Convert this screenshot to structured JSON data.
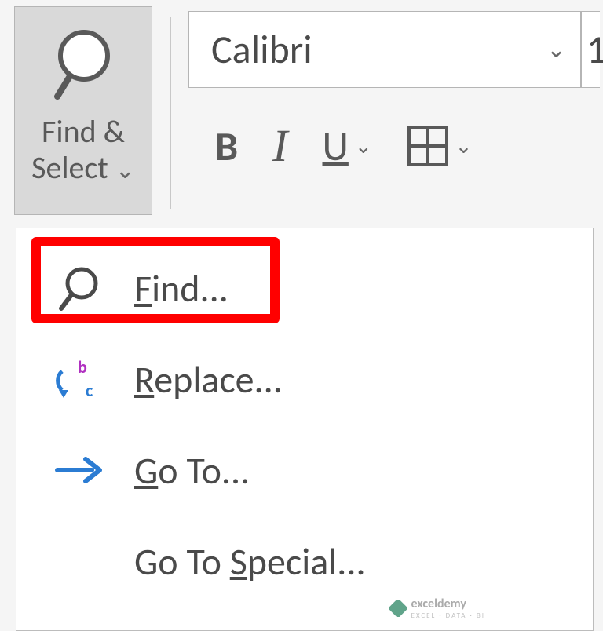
{
  "ribbon": {
    "find_select": {
      "label": "Find &\nSelect"
    },
    "font_name": "Calibri",
    "font_size_partial": "1",
    "bold": "B",
    "italic": "I",
    "underline": "U"
  },
  "menu": {
    "find": {
      "prefix": "F",
      "rest": "ind..."
    },
    "replace": {
      "prefix": "R",
      "rest": "eplace..."
    },
    "goto": {
      "prefix": "G",
      "rest": "o To..."
    },
    "gotospecial": {
      "before": "Go To ",
      "accel": "S",
      "after": "pecial..."
    }
  },
  "watermark": {
    "brand": "exceldemy",
    "tagline": "EXCEL · DATA · BI"
  }
}
